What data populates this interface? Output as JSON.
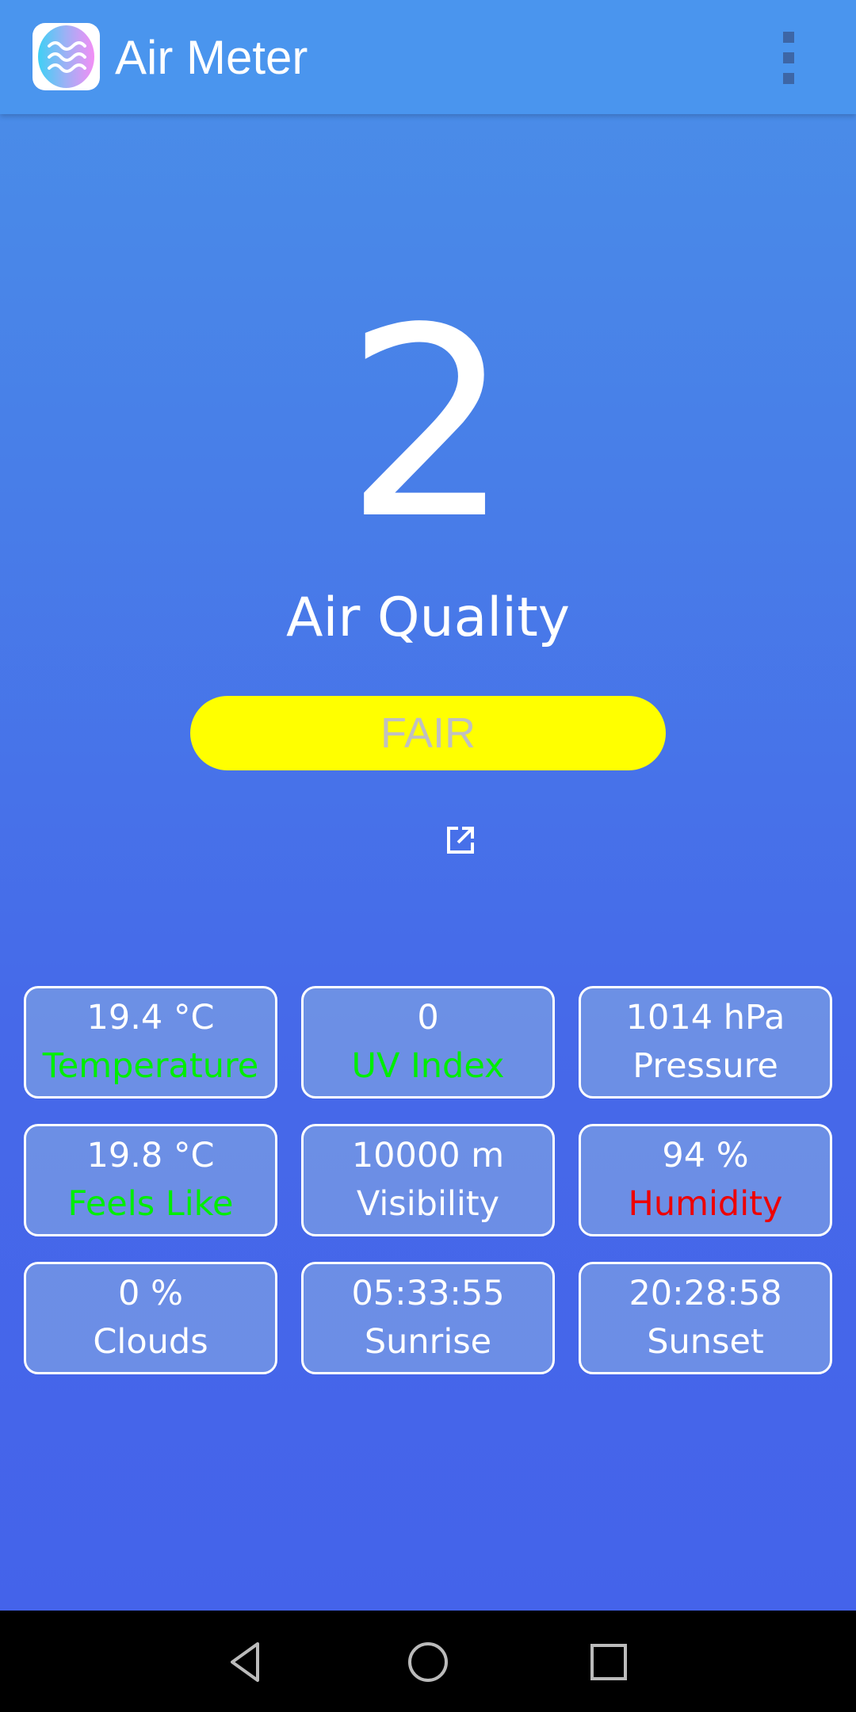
{
  "appbar": {
    "title": "Air Meter",
    "icon": "waves-icon",
    "menu_icon": "more-vert-icon"
  },
  "aqi": {
    "value": "2",
    "label": "Air Quality",
    "status": "FAIR",
    "status_color": "#ffff00",
    "status_text_color": "#c0c0c0",
    "link_icon": "open-in-new-icon"
  },
  "metrics": [
    {
      "value": "19.4 °C",
      "label": "Temperature",
      "label_color": "#00ee00"
    },
    {
      "value": "0",
      "label": "UV Index",
      "label_color": "#00ee00"
    },
    {
      "value": "1014 hPa",
      "label": "Pressure",
      "label_color": "#ffffff"
    },
    {
      "value": "19.8 °C",
      "label": "Feels Like",
      "label_color": "#00ee00"
    },
    {
      "value": "10000 m",
      "label": "Visibility",
      "label_color": "#ffffff"
    },
    {
      "value": "94 %",
      "label": "Humidity",
      "label_color": "#ee0000"
    },
    {
      "value": "0 %",
      "label": "Clouds",
      "label_color": "#ffffff"
    },
    {
      "value": "05:33:55",
      "label": "Sunrise",
      "label_color": "#ffffff"
    },
    {
      "value": "20:28:58",
      "label": "Sunset",
      "label_color": "#ffffff"
    }
  ],
  "navbar": {
    "back": "back-icon",
    "home": "home-icon",
    "recents": "recents-icon"
  }
}
